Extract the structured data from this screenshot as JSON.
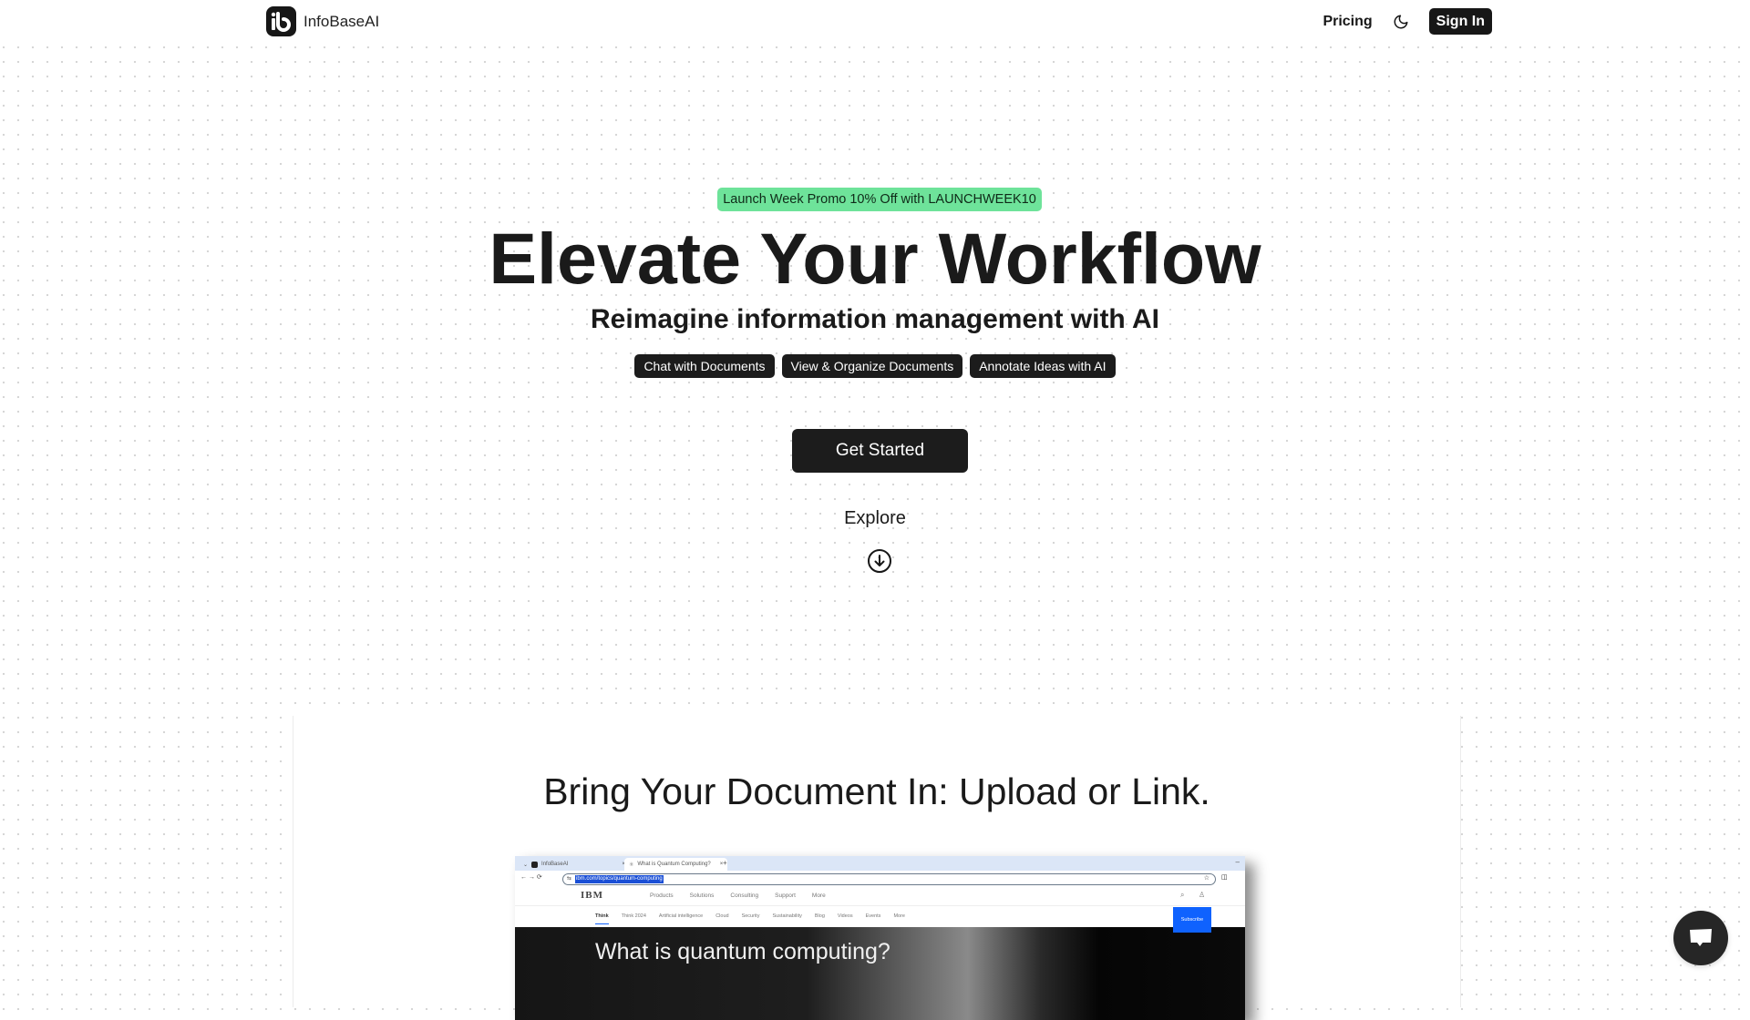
{
  "header": {
    "brand": "InfoBaseAI",
    "logo_icon": "ib-logo-icon",
    "nav": {
      "pricing": "Pricing",
      "theme_icon": "moon-icon",
      "sign_in": "Sign In"
    }
  },
  "hero": {
    "promo": "Launch Week Promo 10% Off with LAUNCHWEEK10",
    "title": "Elevate Your Workflow",
    "subtitle": "Reimagine information management with AI",
    "features": [
      "Chat with Documents",
      "View & Organize Documents",
      "Annotate Ideas with AI"
    ],
    "cta": "Get Started",
    "explore": "Explore",
    "explore_icon": "arrow-down-circle-icon"
  },
  "colors": {
    "promo_bg": "#6ee39a",
    "dark": "#1c1c1c",
    "accent_blue": "#0f62fe"
  },
  "section": {
    "title": "Bring Your Document In: Upload or Link.",
    "screenshot": {
      "tabs": [
        "InfoBaseAI",
        "What is Quantum Computing?"
      ],
      "url": "ibm.com/topics/quantum-computing",
      "site_logo": "IBM",
      "primary_nav": [
        "Products",
        "Solutions",
        "Consulting",
        "Support",
        "More"
      ],
      "secondary_nav": [
        "Think",
        "Think 2024",
        "Artificial intelligence",
        "Cloud",
        "Security",
        "Sustainability",
        "Blog",
        "Videos",
        "Events",
        "More"
      ],
      "subscribe": "Subscribe",
      "hero_text": "What is quantum computing?"
    }
  },
  "chat_widget": {
    "icon": "chat-bubble-icon"
  }
}
